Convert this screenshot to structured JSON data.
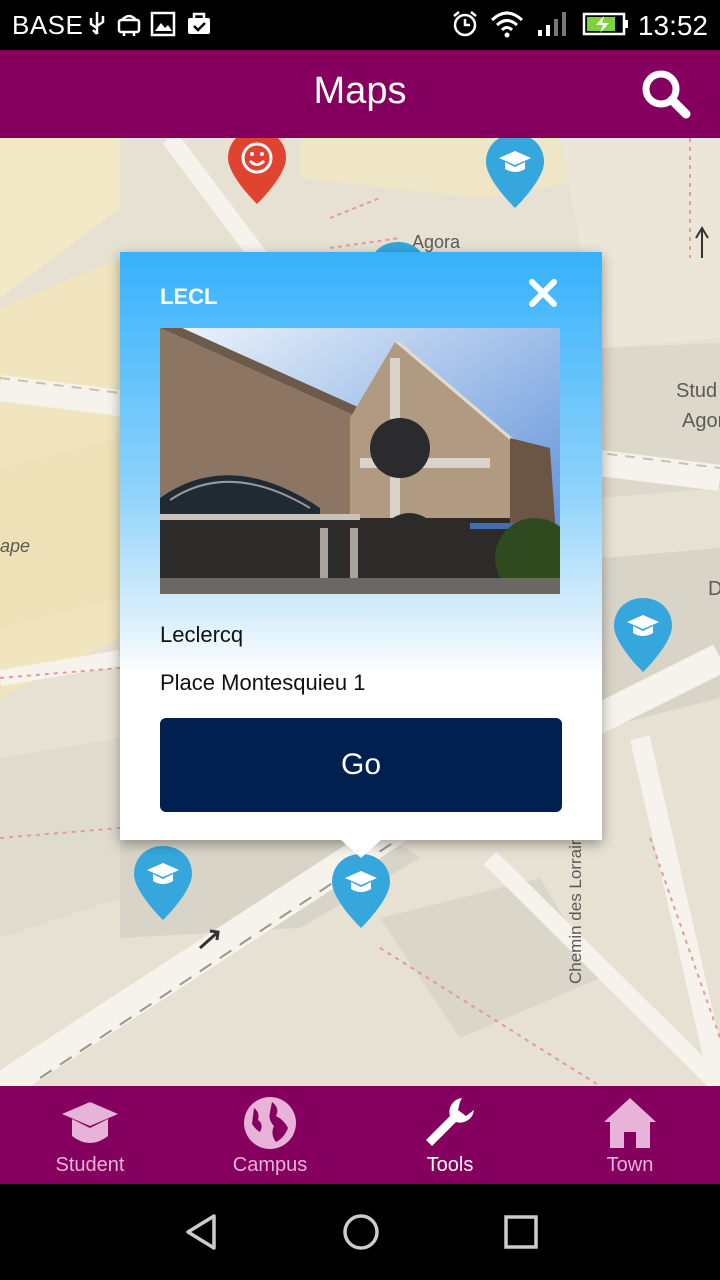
{
  "status_bar": {
    "carrier": "BASE",
    "time": "13:52"
  },
  "app_bar": {
    "title": "Maps",
    "search_icon": "search-icon"
  },
  "map": {
    "labels": {
      "agora": "Agora",
      "stud": "Stud",
      "agor": "Agor",
      "ape": "ape",
      "d": "D",
      "chemin": "Chemin des Lorrains"
    },
    "pin_color": "#35a7dd",
    "pin_alt_color": "#e0432f"
  },
  "popup": {
    "code": "LECL",
    "name": "Leclercq",
    "address": "Place Montesquieu 1",
    "go_label": "Go",
    "accent": "#01204f"
  },
  "tabs": [
    {
      "label": "Student",
      "icon": "graduation-cap-icon",
      "active": false
    },
    {
      "label": "Campus",
      "icon": "globe-icon",
      "active": false
    },
    {
      "label": "Tools",
      "icon": "wrench-icon",
      "active": true
    },
    {
      "label": "Town",
      "icon": "home-icon",
      "active": false
    }
  ],
  "colors": {
    "brand": "#85005e",
    "popup_top": "#36b2fc"
  }
}
